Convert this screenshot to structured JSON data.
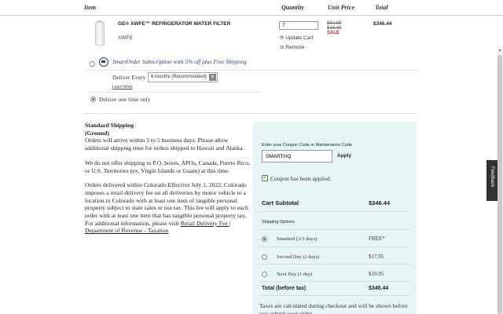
{
  "table_header": {
    "item": "Item",
    "quantity": "Quantity",
    "unit_price": "Unit Price",
    "total": "Total"
  },
  "product": {
    "name": "GE® XWFE™ REFRIGERATOR WATER FILTER",
    "sku": "XWFE",
    "quantity": "7",
    "update_label": "Update Cart",
    "remove_label": "Remove",
    "price_list": "$64.99",
    "price_was": "$49.49",
    "sale_label": "SALE",
    "line_total": "$346.44"
  },
  "subscription": {
    "title": "SmartOrder Subscription with 5% off plus Free Shipping",
    "deliver_every_label": "Deliver Every",
    "frequency": "6 months (Recommended)",
    "learn_more": "Learn More"
  },
  "one_time": {
    "label": "Deliver one time only",
    "selected": true
  },
  "shipping_info": {
    "heading": "Standard Shipping",
    "subheading": "(Ground)",
    "p1": "Orders will arrive within 3 to 5 business days. Please allow additional shipping time for orders shipped to Hawaii and Alaska.",
    "p2": "We do not offer shipping to P.O. boxes, APOs, Canada, Puerto Rico, or U.S. Territories (ex. Virgin Islands or Guam) at this time.",
    "p3": "Orders delivered within Colorado Effective July 1, 2022, Colorado imposes a retail delivery fee on all deliveries by motor vehicle to a location in Colorado with at least one item of tangible personal property subject to state sales or use tax. This fee will apply to each order with at least one item that has tangible personal property tax. For additional information, please visit ",
    "link": "Retail Delivery Fee | Department of Revenue - Taxation"
  },
  "summary": {
    "coupon_label": "Enter your Coupon Code or Maintenance Code",
    "coupon_value": "SMARTHQ",
    "apply_label": "Apply",
    "coupon_applied": "Coupon has been applied.",
    "subtotal_label": "Cart Subtotal",
    "subtotal_value": "$346.44",
    "shipping_options_label": "Shipping Options",
    "options": [
      {
        "label": "Standard (3-5 days)",
        "price": "FREE*",
        "selected": true
      },
      {
        "label": "Second Day (2 days)",
        "price": "$17.95",
        "selected": false
      },
      {
        "label": "Next Day (1 day)",
        "price": "$19.95",
        "selected": false
      }
    ],
    "total_label": "Total (before tax)",
    "total_value": "$346.44",
    "tax_note": "Taxes are calculated during checkout and will be shown before you submit your order."
  },
  "feedback_label": "Feedback"
}
